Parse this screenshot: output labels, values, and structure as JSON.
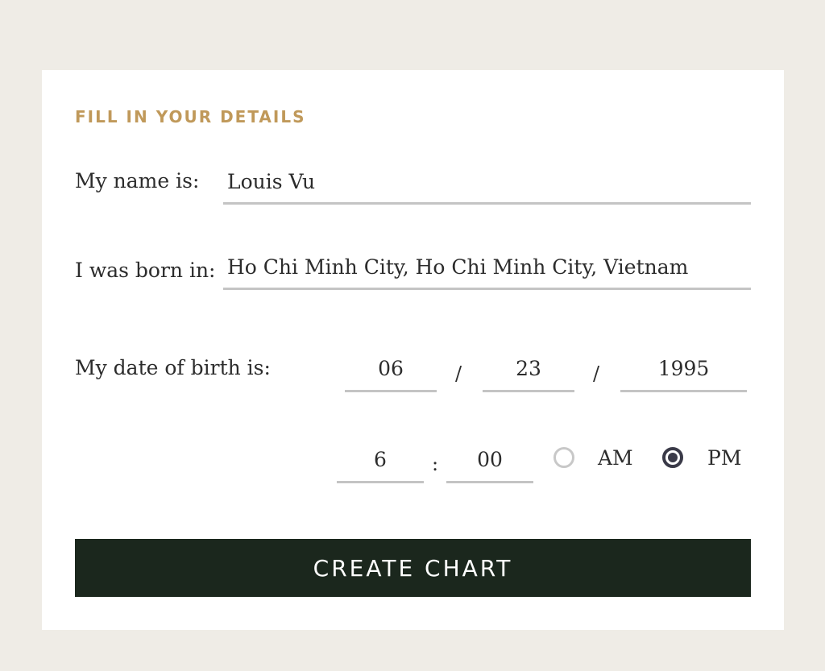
{
  "form": {
    "title": "FILL IN YOUR DETAILS",
    "name_label": "My name is:",
    "name_value": "Louis Vu",
    "born_label": "I was born in:",
    "born_value": "Ho Chi Minh City, Ho Chi Minh City, Vietnam",
    "dob_label": "My date of birth is:",
    "dob_month": "06",
    "dob_day": "23",
    "dob_year": "1995",
    "date_separator": "/",
    "time_hour": "6",
    "time_minute": "00",
    "time_separator": ":",
    "am_label": "AM",
    "pm_label": "PM",
    "selected_period": "PM",
    "submit_label": "CREATE CHART"
  },
  "colors": {
    "background": "#efece6",
    "accent_title": "#c0995a",
    "button": "#1b271d",
    "underline": "#c4c4c4"
  }
}
